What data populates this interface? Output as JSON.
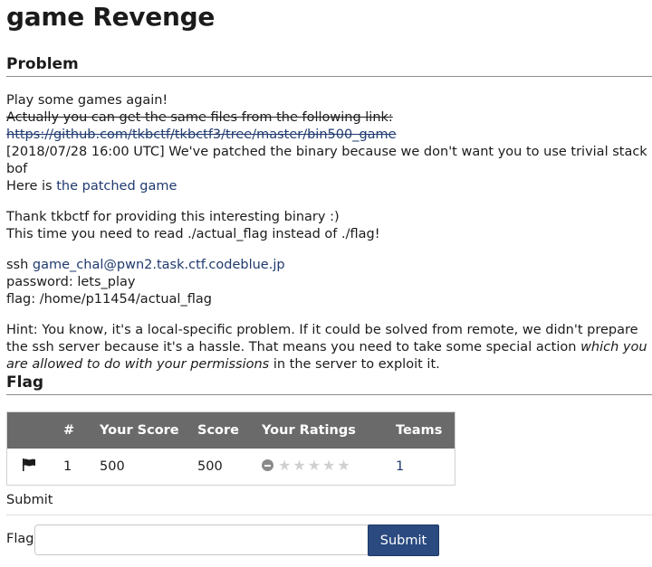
{
  "title": "game Revenge",
  "problem": {
    "heading": "Problem",
    "line1": "Play some games again!",
    "strike_line": "Actually you can get the same files from the following link:",
    "strike_link": "https://github.com/tkbctf/tkbctf3/tree/master/bin500_game",
    "update_line": "[2018/07/28 16:00 UTC] We've patched the binary because we don't want you to use trivial stack bof",
    "here_prefix": "Here is ",
    "patched_link": "the patched game",
    "thanks_line": "Thank tkbctf for providing this interesting binary :)",
    "read_line": "This time you need to read ./actual_flag instead of ./flag!",
    "ssh_prefix": "ssh ",
    "ssh_link": "game_chal@pwn2.task.ctf.codeblue.jp",
    "password_line": "password: lets_play",
    "flag_path_line": "flag: /home/p11454/actual_flag",
    "hint_part1": "Hint: You know, it's a local-specific problem. If it could be solved from remote, we didn't prepare the ssh server because it's a hassle. That means you need to take some special action ",
    "hint_em": "which you are allowed to do with your permissions",
    "hint_part2": " in the server to exploit it."
  },
  "flag_section": {
    "heading": "Flag",
    "table": {
      "headers": [
        "",
        "#",
        "Your Score",
        "Score",
        "Your Ratings",
        "Teams"
      ],
      "row": {
        "icon": "flag-icon",
        "number": "1",
        "your_score": "500",
        "score": "500",
        "rating_icons": [
          "minus-circle-icon",
          "star-icon",
          "star-icon",
          "star-icon",
          "star-icon",
          "star-icon"
        ],
        "teams": "1"
      }
    },
    "submit_text": "Submit",
    "form": {
      "label": "Flag",
      "input_value": "",
      "input_placeholder": "",
      "button_label": "Submit"
    }
  },
  "colors": {
    "link": "#1f3a6f",
    "table_header_bg": "#6a6a6a",
    "button_bg": "#2a4a80"
  }
}
